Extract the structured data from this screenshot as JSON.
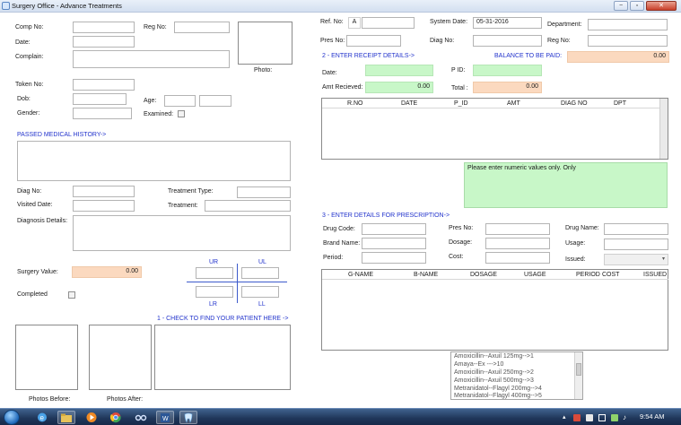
{
  "window": {
    "title": "Surgery Office - Advance Treatments",
    "minimize_glyph": "−",
    "maximize_glyph": "▫",
    "close_glyph": "✕"
  },
  "patient": {
    "comp_no_label": "Comp No:",
    "reg_no_label": "Reg No:",
    "date_label": "Date:",
    "complain_label": "Complain:",
    "photo_label": "Photo:",
    "token_no_label": "Token No:",
    "dob_label": "Dob:",
    "age_label": "Age:",
    "gender_label": "Gender:",
    "examined_label": "Examined:"
  },
  "history": {
    "heading": "PASSED MEDICAL HISTORY->",
    "diag_no_label": "Diag No:",
    "treatment_type_label": "Treatment Type:",
    "visited_date_label": "Visited Date:",
    "treatment_label": "Treatment:",
    "diagnosis_details_label": "Diagnosis Details:"
  },
  "surgery": {
    "value_label": "Surgery Value:",
    "value": "0.00",
    "completed_label": "Completed"
  },
  "teeth": {
    "ur": "UR",
    "ul": "UL",
    "lr": "LR",
    "ll": "LL"
  },
  "find_patient": {
    "heading": "1 - CHECK TO FIND YOUR PATIENT HERE ->",
    "photos_before_label": "Photos Before:",
    "photos_after_label": "Photos After:"
  },
  "header_right": {
    "ref_no_label": "Ref. No:",
    "ref_prefix": "A",
    "system_date_label": "System Date:",
    "system_date": "05-31-2016",
    "department_label": "Department:",
    "pres_no_label": "Pres No:",
    "diag_no_label": "Diag No:",
    "reg_no_label": "Reg No:"
  },
  "receipt": {
    "heading": "2 - ENTER RECEIPT DETAILS->",
    "balance_label": "BALANCE TO BE PAID:",
    "balance_value": "0.00",
    "date_label": "Date:",
    "pid_label": "P ID:",
    "amt_received_label": "Amt Recieved:",
    "amt_received_value": "0.00",
    "total_label": "Total :",
    "total_value": "0.00",
    "columns": [
      "R.NO",
      "DATE",
      "P_ID",
      "AMT",
      "DIAG NO",
      "DPT"
    ]
  },
  "notice": {
    "text": "Please enter numeric values only. Only"
  },
  "prescription": {
    "heading": "3 - ENTER DETAILS FOR PRESCRIPTION->",
    "drug_code_label": "Drug Code:",
    "pres_no_label": "Pres No:",
    "drug_name_label": "Drug Name:",
    "brand_name_label": "Brand Name:",
    "dosage_label": "Dosage:",
    "usage_label": "Usage:",
    "period_label": "Period:",
    "cost_label": "Cost:",
    "issued_label": "Issued:",
    "columns": [
      "G-NAME",
      "B-NAME",
      "DOSAGE",
      "USAGE",
      "PERIOD",
      "COST",
      "ISSUED"
    ]
  },
  "drug_list": [
    "Amoxicillin--Axuil 125mg-->1",
    "Amaya--Ex --->10",
    "Amoxicillin--Axuil 250mg-->2",
    "Amoxicillin--Axuil 500mg-->3",
    "Metranidatol--Flagyl 200mg-->4",
    "Metranidatol--Flagyl 400mg-->5"
  ],
  "taskbar": {
    "time": "9:54 AM"
  }
}
